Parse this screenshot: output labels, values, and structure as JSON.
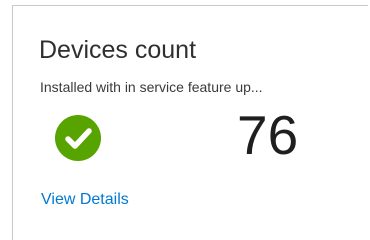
{
  "tile": {
    "title": "Devices count",
    "subtitle": "Installed with in service feature up...",
    "status_icon": "checkmark-circle-icon",
    "status_color": "#57a300",
    "count": "76",
    "link_label": "View Details",
    "link_color": "#0078d4"
  }
}
